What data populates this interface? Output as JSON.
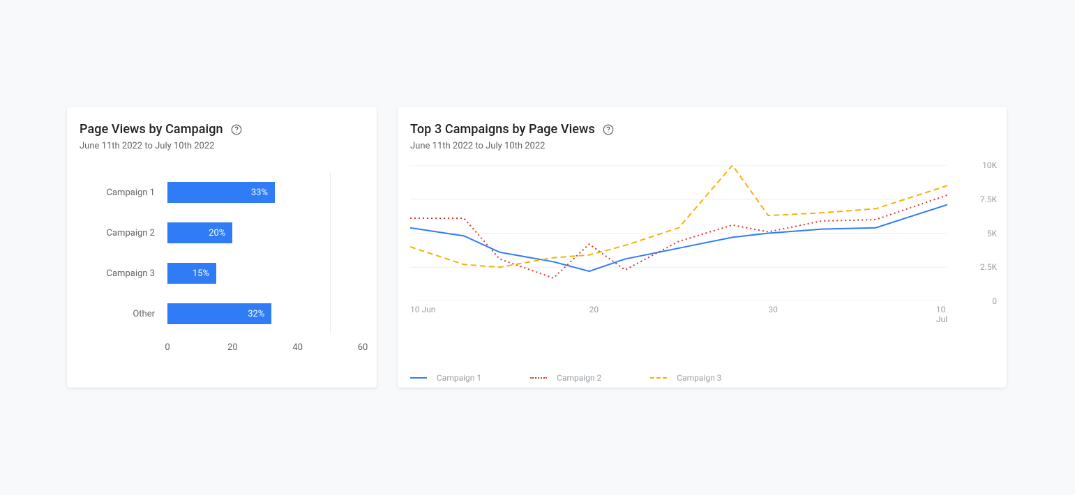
{
  "left_card": {
    "title": "Page Views by Campaign",
    "subtitle": "June 11th 2022 to July 10th 2022"
  },
  "right_card": {
    "title": "Top 3 Campaigns by Page Views",
    "subtitle": "June 11th 2022 to July 10th 2022"
  },
  "legend": {
    "c1": "Campaign 1",
    "c2": "Campaign 2",
    "c3": "Campaign 3"
  },
  "chart_data": [
    {
      "type": "bar",
      "orientation": "horizontal",
      "title": "Page Views by Campaign",
      "categories": [
        "Campaign 1",
        "Campaign 2",
        "Campaign 3",
        "Other"
      ],
      "values": [
        33,
        20,
        15,
        32
      ],
      "value_labels": [
        "33%",
        "20%",
        "15%",
        "32%"
      ],
      "xlabel": "",
      "ylabel": "",
      "xlim": [
        0,
        60
      ],
      "xtick_labels": [
        "0",
        "20",
        "40",
        "60"
      ],
      "bar_color": "#2f7cf6"
    },
    {
      "type": "line",
      "title": "Top 3 Campaigns by Page Views",
      "x": [
        10,
        13,
        15,
        18,
        20,
        22,
        25,
        28,
        30,
        33,
        36,
        40
      ],
      "xtick_labels": [
        "10 Jun",
        "20",
        "30",
        "10 Jul"
      ],
      "series": [
        {
          "name": "Campaign 1",
          "style": "solid",
          "color": "#2f7cf6",
          "values": [
            5400,
            4800,
            3600,
            2900,
            2200,
            3100,
            3900,
            4700,
            5000,
            5300,
            5400,
            7100
          ]
        },
        {
          "name": "Campaign 2",
          "style": "dotted",
          "color": "#d93025",
          "values": [
            6100,
            6100,
            3100,
            1700,
            4200,
            2300,
            4400,
            5600,
            5100,
            5900,
            6000,
            7800
          ]
        },
        {
          "name": "Campaign 3",
          "style": "dashed",
          "color": "#f2b400",
          "values": [
            4000,
            2700,
            2500,
            3200,
            3400,
            4100,
            5400,
            10000,
            6300,
            6500,
            6800,
            8500
          ]
        }
      ],
      "ylim": [
        0,
        10000
      ],
      "ytick_values": [
        0,
        2500,
        5000,
        7500,
        10000
      ],
      "ytick_labels": [
        "0",
        "2.5K",
        "5K",
        "7.5K",
        "10K"
      ]
    }
  ]
}
